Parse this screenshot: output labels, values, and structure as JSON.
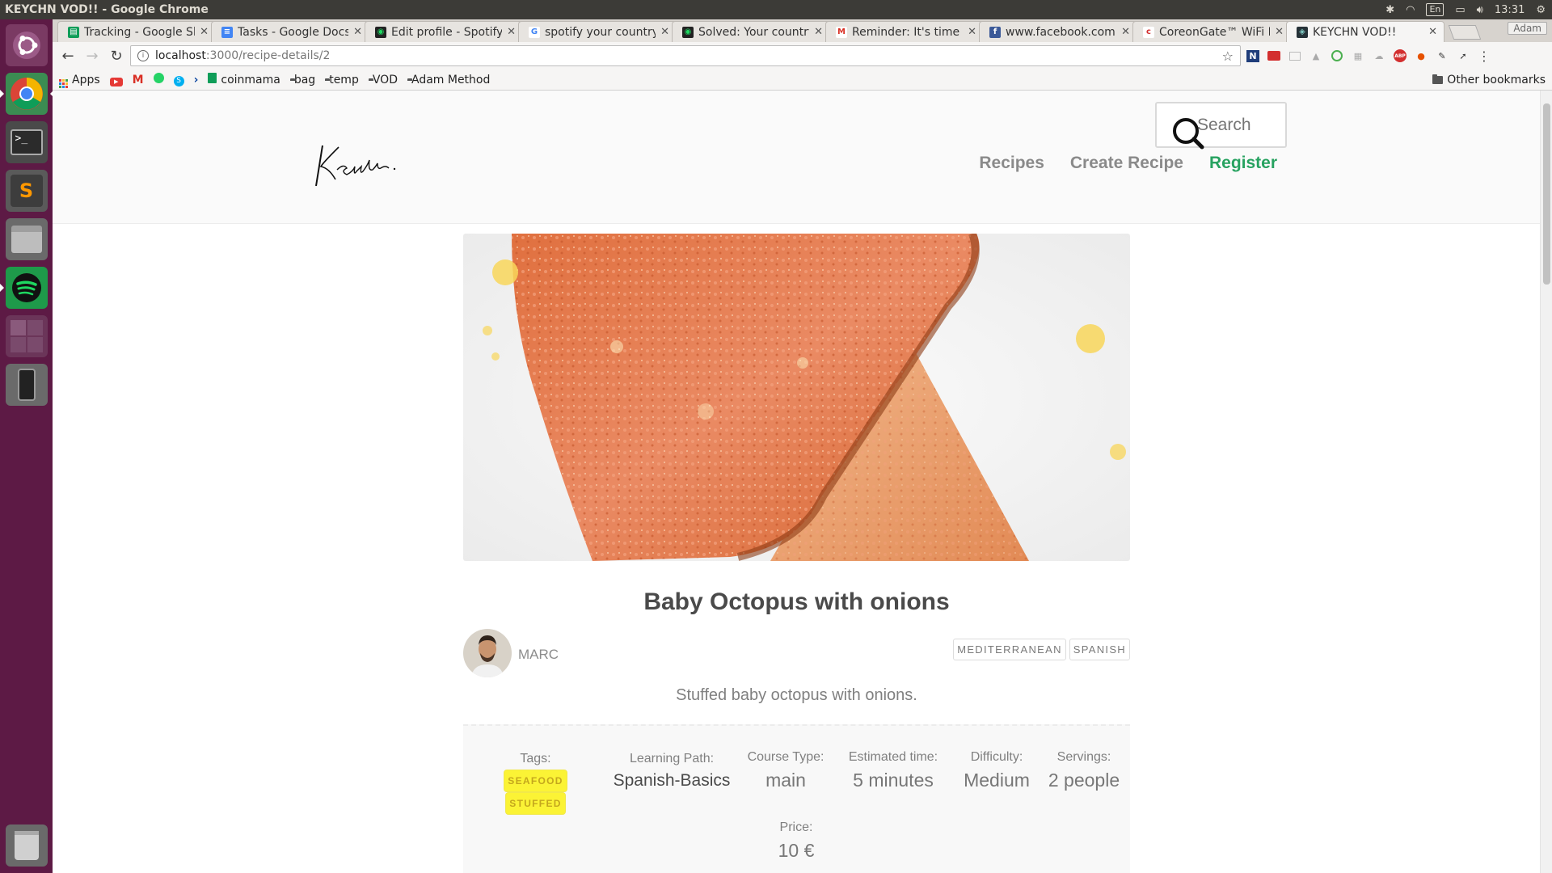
{
  "os": {
    "window_title": "KEYCHN VOD!! - Google Chrome",
    "keyboard_layout": "En",
    "clock": "13:31",
    "launcher_icons": [
      "ubuntu-dash-icon",
      "chrome-icon",
      "terminal-icon",
      "sublime-text-icon",
      "files-icon",
      "spotify-icon",
      "workspace-switcher-icon",
      "phone-device-icon",
      "trash-icon"
    ]
  },
  "browser": {
    "tabs": [
      {
        "label": "Tracking - Google She",
        "favicon": "sheets-icon",
        "active": false
      },
      {
        "label": "Tasks - Google Docs",
        "favicon": "docs-icon",
        "active": false
      },
      {
        "label": "Edit profile - Spotify",
        "favicon": "spotify-icon",
        "active": false
      },
      {
        "label": "spotify your country",
        "favicon": "google-icon",
        "active": false
      },
      {
        "label": "Solved: Your country",
        "favicon": "spotify-icon",
        "active": false
      },
      {
        "label": "Reminder: It's time t",
        "favicon": "gmail-icon",
        "active": false
      },
      {
        "label": "www.facebook.com",
        "favicon": "facebook-icon",
        "active": false
      },
      {
        "label": "CoreonGate™ WiFi L",
        "favicon": "coreon-icon",
        "active": false
      },
      {
        "label": "KEYCHN VOD!!",
        "favicon": "keychn-icon",
        "active": true
      }
    ],
    "profile_name": "Adam",
    "url_host": "localhost",
    "url_path": ":3000/recipe-details/2",
    "bookmarks": [
      {
        "label": "Apps",
        "icon": "apps-grid-icon"
      },
      {
        "label": "",
        "icon": "youtube-icon"
      },
      {
        "label": "",
        "icon": "gmail-icon"
      },
      {
        "label": "",
        "icon": "whatsapp-icon"
      },
      {
        "label": "",
        "icon": "skype-icon"
      },
      {
        "label": "",
        "icon": "chevron-icon"
      },
      {
        "label": "coinmama",
        "icon": "sheets-icon"
      },
      {
        "label": "bag",
        "icon": "folder-icon"
      },
      {
        "label": "temp",
        "icon": "folder-icon"
      },
      {
        "label": "VOD",
        "icon": "folder-icon"
      },
      {
        "label": "Adam Method",
        "icon": "folder-icon"
      }
    ],
    "other_bookmarks": "Other bookmarks"
  },
  "site": {
    "logo_text": "Keychn.",
    "search_placeholder": "Search",
    "nav": [
      {
        "label": "Recipes",
        "accent": false
      },
      {
        "label": "Create Recipe",
        "accent": false
      },
      {
        "label": "Register",
        "accent": true
      }
    ],
    "accent_color": "#27a260"
  },
  "recipe": {
    "title": "Baby Octopus with onions",
    "author": "MARC",
    "cuisines": [
      "MEDITERRANEAN",
      "SPANISH"
    ],
    "description": "Stuffed baby octopus with onions.",
    "tags_label": "Tags:",
    "tags": [
      "SEAFOOD",
      "STUFFED"
    ],
    "learning_path_label": "Learning Path:",
    "learning_path": "Spanish-Basics",
    "course_type_label": "Course Type:",
    "course_type": "main",
    "estimated_time_label": "Estimated time:",
    "estimated_time": "5 minutes",
    "difficulty_label": "Difficulty:",
    "difficulty": "Medium",
    "servings_label": "Servings:",
    "servings": "2 people",
    "price_label": "Price:",
    "price": "10 €"
  }
}
